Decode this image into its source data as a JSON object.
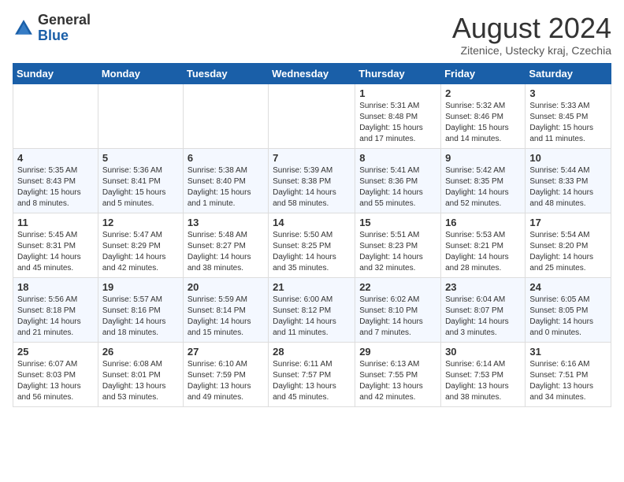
{
  "header": {
    "logo_general": "General",
    "logo_blue": "Blue",
    "title": "August 2024",
    "subtitle": "Zitenice, Ustecky kraj, Czechia"
  },
  "days_of_week": [
    "Sunday",
    "Monday",
    "Tuesday",
    "Wednesday",
    "Thursday",
    "Friday",
    "Saturday"
  ],
  "weeks": [
    [
      {
        "day": "",
        "info": ""
      },
      {
        "day": "",
        "info": ""
      },
      {
        "day": "",
        "info": ""
      },
      {
        "day": "",
        "info": ""
      },
      {
        "day": "1",
        "info": "Sunrise: 5:31 AM\nSunset: 8:48 PM\nDaylight: 15 hours\nand 17 minutes."
      },
      {
        "day": "2",
        "info": "Sunrise: 5:32 AM\nSunset: 8:46 PM\nDaylight: 15 hours\nand 14 minutes."
      },
      {
        "day": "3",
        "info": "Sunrise: 5:33 AM\nSunset: 8:45 PM\nDaylight: 15 hours\nand 11 minutes."
      }
    ],
    [
      {
        "day": "4",
        "info": "Sunrise: 5:35 AM\nSunset: 8:43 PM\nDaylight: 15 hours\nand 8 minutes."
      },
      {
        "day": "5",
        "info": "Sunrise: 5:36 AM\nSunset: 8:41 PM\nDaylight: 15 hours\nand 5 minutes."
      },
      {
        "day": "6",
        "info": "Sunrise: 5:38 AM\nSunset: 8:40 PM\nDaylight: 15 hours\nand 1 minute."
      },
      {
        "day": "7",
        "info": "Sunrise: 5:39 AM\nSunset: 8:38 PM\nDaylight: 14 hours\nand 58 minutes."
      },
      {
        "day": "8",
        "info": "Sunrise: 5:41 AM\nSunset: 8:36 PM\nDaylight: 14 hours\nand 55 minutes."
      },
      {
        "day": "9",
        "info": "Sunrise: 5:42 AM\nSunset: 8:35 PM\nDaylight: 14 hours\nand 52 minutes."
      },
      {
        "day": "10",
        "info": "Sunrise: 5:44 AM\nSunset: 8:33 PM\nDaylight: 14 hours\nand 48 minutes."
      }
    ],
    [
      {
        "day": "11",
        "info": "Sunrise: 5:45 AM\nSunset: 8:31 PM\nDaylight: 14 hours\nand 45 minutes."
      },
      {
        "day": "12",
        "info": "Sunrise: 5:47 AM\nSunset: 8:29 PM\nDaylight: 14 hours\nand 42 minutes."
      },
      {
        "day": "13",
        "info": "Sunrise: 5:48 AM\nSunset: 8:27 PM\nDaylight: 14 hours\nand 38 minutes."
      },
      {
        "day": "14",
        "info": "Sunrise: 5:50 AM\nSunset: 8:25 PM\nDaylight: 14 hours\nand 35 minutes."
      },
      {
        "day": "15",
        "info": "Sunrise: 5:51 AM\nSunset: 8:23 PM\nDaylight: 14 hours\nand 32 minutes."
      },
      {
        "day": "16",
        "info": "Sunrise: 5:53 AM\nSunset: 8:21 PM\nDaylight: 14 hours\nand 28 minutes."
      },
      {
        "day": "17",
        "info": "Sunrise: 5:54 AM\nSunset: 8:20 PM\nDaylight: 14 hours\nand 25 minutes."
      }
    ],
    [
      {
        "day": "18",
        "info": "Sunrise: 5:56 AM\nSunset: 8:18 PM\nDaylight: 14 hours\nand 21 minutes."
      },
      {
        "day": "19",
        "info": "Sunrise: 5:57 AM\nSunset: 8:16 PM\nDaylight: 14 hours\nand 18 minutes."
      },
      {
        "day": "20",
        "info": "Sunrise: 5:59 AM\nSunset: 8:14 PM\nDaylight: 14 hours\nand 15 minutes."
      },
      {
        "day": "21",
        "info": "Sunrise: 6:00 AM\nSunset: 8:12 PM\nDaylight: 14 hours\nand 11 minutes."
      },
      {
        "day": "22",
        "info": "Sunrise: 6:02 AM\nSunset: 8:10 PM\nDaylight: 14 hours\nand 7 minutes."
      },
      {
        "day": "23",
        "info": "Sunrise: 6:04 AM\nSunset: 8:07 PM\nDaylight: 14 hours\nand 3 minutes."
      },
      {
        "day": "24",
        "info": "Sunrise: 6:05 AM\nSunset: 8:05 PM\nDaylight: 14 hours\nand 0 minutes."
      }
    ],
    [
      {
        "day": "25",
        "info": "Sunrise: 6:07 AM\nSunset: 8:03 PM\nDaylight: 13 hours\nand 56 minutes."
      },
      {
        "day": "26",
        "info": "Sunrise: 6:08 AM\nSunset: 8:01 PM\nDaylight: 13 hours\nand 53 minutes."
      },
      {
        "day": "27",
        "info": "Sunrise: 6:10 AM\nSunset: 7:59 PM\nDaylight: 13 hours\nand 49 minutes."
      },
      {
        "day": "28",
        "info": "Sunrise: 6:11 AM\nSunset: 7:57 PM\nDaylight: 13 hours\nand 45 minutes."
      },
      {
        "day": "29",
        "info": "Sunrise: 6:13 AM\nSunset: 7:55 PM\nDaylight: 13 hours\nand 42 minutes."
      },
      {
        "day": "30",
        "info": "Sunrise: 6:14 AM\nSunset: 7:53 PM\nDaylight: 13 hours\nand 38 minutes."
      },
      {
        "day": "31",
        "info": "Sunrise: 6:16 AM\nSunset: 7:51 PM\nDaylight: 13 hours\nand 34 minutes."
      }
    ]
  ]
}
